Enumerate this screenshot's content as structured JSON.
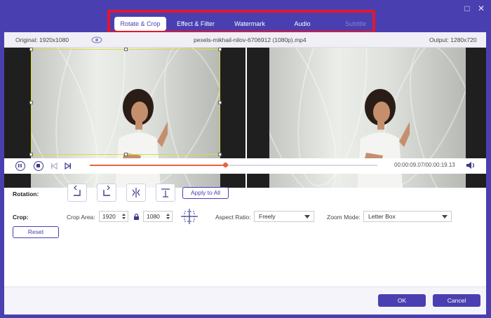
{
  "tabs": [
    {
      "label": "Rotate & Crop",
      "active": true
    },
    {
      "label": "Effect & Filter"
    },
    {
      "label": "Watermark"
    },
    {
      "label": "Audio"
    },
    {
      "label": "Subtitle",
      "disabled": true
    }
  ],
  "info": {
    "original": "Original: 1920x1080",
    "filename": "pexels-mikhail-nilov-6706912 (1080p).mp4",
    "output": "Output: 1280x720"
  },
  "playback": {
    "timecode": "00:00:09.07/00:00:19.13",
    "progress": 0.47
  },
  "rotation": {
    "label": "Rotation:",
    "apply_all": "Apply to All"
  },
  "crop": {
    "label": "Crop:",
    "area_label": "Crop Area:",
    "width": "1920",
    "height": "1080",
    "aspect_label": "Aspect Ratio:",
    "aspect_value": "Freely",
    "zoom_label": "Zoom Mode:",
    "zoom_value": "Letter Box",
    "reset": "Reset"
  },
  "footer": {
    "ok": "OK",
    "cancel": "Cancel"
  },
  "colors": {
    "accent": "#4a3fb0",
    "progress": "#e8623a",
    "highlight": "#e0182e"
  }
}
